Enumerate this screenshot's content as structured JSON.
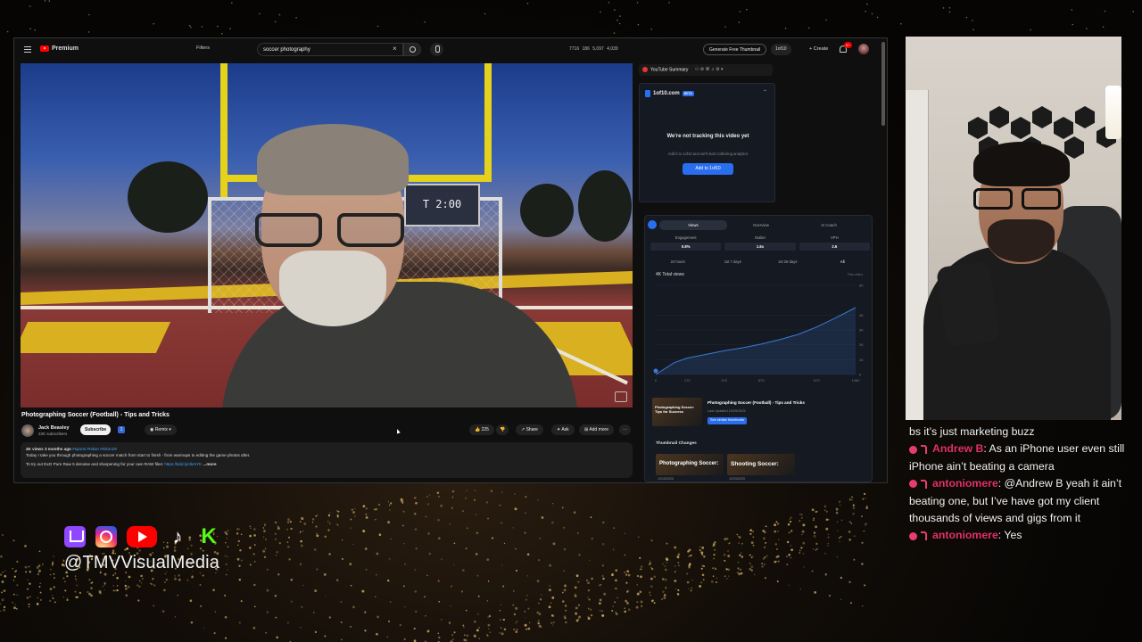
{
  "youtube": {
    "logo_label": "Premium",
    "filters_label": "Filters",
    "search_value": "soccer photography",
    "header_stats": "7716  186  5,097  4,039",
    "generate_thumbnail_label": "Generate Free Thumbnail",
    "tenof10_label": "1of10",
    "create_label": "Create",
    "notifications_badge": "9+",
    "scoreboard_text": "T 2:00",
    "video_title": "Photographing Soccer (Football) - Tips and Tricks",
    "channel_name": "Jack Beasley",
    "channel_subs": "22K subscribers",
    "subscribe_label": "Subscribe",
    "remix_label": "Remix",
    "like_count": "225",
    "share_label": "Share",
    "ask_label": "Ask",
    "add_more_label": "Add more",
    "description": {
      "meta": "4K views  3 months ago",
      "tags": "#sports #nikon #nikonz9",
      "line1": "Today I take you through photographing a soccer match from start to finish - from warmups to editing the game photos after.",
      "line2": "To try out DxO Pure Raw 5 denoise and sharpening for your own RAW files:",
      "link": "https://tidd.ly/4kmYK",
      "more": "...more"
    }
  },
  "extension": {
    "summary_label": "YouTube Summary",
    "card_title": "1of10.com",
    "beta_label": "BETA",
    "not_tracking": "We're not tracking this video yet",
    "not_tracking_sub": "Add it to 1of10 and we'll start collecting analytics",
    "add_button": "Add to 1of10",
    "tabs": [
      "Views",
      "Overview",
      "AI Coach"
    ],
    "metrics": [
      {
        "label": "Engagement",
        "value": "0.8%"
      },
      {
        "label": "Outlier",
        "value": "1.6x"
      },
      {
        "label": "VPH",
        "value": "2.6"
      }
    ],
    "ranges": [
      "24 hours",
      "1st 7 days",
      "1st 28 days",
      "All"
    ],
    "chart_header": "4K  Total views",
    "chart_legend": "This video",
    "thumb_title": "Photographing Soccer (Football) - Tips and Tricks",
    "thumb_date": "Last Updated 10/29/2025",
    "see_similar": "See similar thumbnails",
    "thumbnail_changes_label": "Thumbnail Changes",
    "thumb_text_1": "Photographing Soccer:",
    "thumb_text_2": "Shooting Soccer:",
    "thumb_overlay_small": "Photographing Soccer: Tips for Success",
    "thumb_date_1": "10/15/2025",
    "thumb_date_2": "10/29/2025"
  },
  "chart_data": {
    "type": "area",
    "x": [
      0,
      100,
      170,
      270,
      370,
      470,
      570,
      670,
      770,
      870,
      970,
      1080
    ],
    "y": [
      0,
      800,
      1100,
      1350,
      1600,
      1800,
      2050,
      2350,
      2700,
      3200,
      3800,
      4500
    ],
    "xticks": [
      "0",
      "170",
      "370",
      "570",
      "870",
      "1080"
    ],
    "yticks": [
      "0",
      "1K",
      "2K",
      "3K",
      "4K",
      "6K"
    ],
    "ylim": [
      0,
      6000
    ],
    "xlim": [
      0,
      1080
    ],
    "color": "#3a7bd5"
  },
  "chat": [
    {
      "user": "",
      "text": "bs it’s just marketing buzz"
    },
    {
      "user": "Andrew B",
      "text": ": As an iPhone user even still iPhone ain’t beating a camera"
    },
    {
      "user": "antoniomere",
      "text": ": @Andrew B yeah it ain’t beating one, but I’ve have got my client thousands of views and gigs from it"
    },
    {
      "user": "antoniomere",
      "text": ": Yes"
    }
  ],
  "socials": {
    "handle": "@TMVVisualMedia",
    "icons": [
      "twitch-icon",
      "instagram-icon",
      "youtube-icon",
      "tiktok-icon",
      "kick-icon"
    ]
  }
}
